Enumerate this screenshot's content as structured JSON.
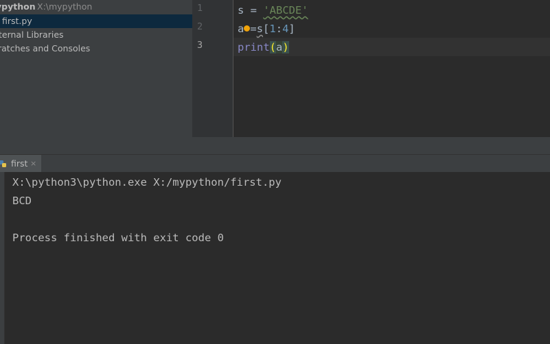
{
  "project_tree": {
    "root_name": "ypython",
    "root_path": "X:\\mypython",
    "items": [
      {
        "label": "first.py",
        "selected": true
      },
      {
        "label": "ternal Libraries"
      },
      {
        "label": "ratches and Consoles"
      }
    ]
  },
  "editor": {
    "line_numbers": [
      "1",
      "2",
      "3"
    ],
    "lines": [
      {
        "var": "s",
        "op": " = ",
        "string": "'ABCDE'"
      },
      {
        "var": "a",
        "op": "=",
        "target": "s",
        "bracket_open": "[",
        "start": "1",
        "colon": ":",
        "stop": "4",
        "bracket_close": "]"
      },
      {
        "func": "print",
        "paren_open": "(",
        "arg": "a",
        "paren_close": ")"
      }
    ],
    "intention_icon": "lightbulb-icon"
  },
  "run_window": {
    "tab_label": "first",
    "tab_close": "×",
    "tab_icon": "python-icon",
    "console_lines": [
      "X:\\python3\\python.exe X:/mypython/first.py",
      "BCD",
      "",
      "Process finished with exit code 0"
    ]
  },
  "colors": {
    "background": "#2b2b2b",
    "panel": "#3c3f41",
    "selection": "#0d293e",
    "string": "#6a8759",
    "builtin": "#8888c6",
    "number": "#6897bb",
    "bracket_match": "#ffef28",
    "bulb": "#f0a30a"
  }
}
